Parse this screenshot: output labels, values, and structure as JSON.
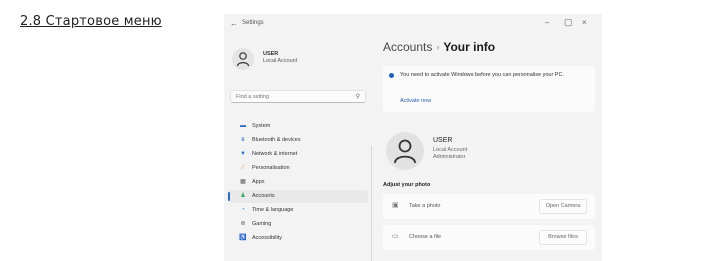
{
  "document": {
    "heading": "2.8 Стартовое меню"
  },
  "window": {
    "title": "Settings",
    "controls": {
      "minimize": "–",
      "maximize": "▢",
      "close": "×"
    }
  },
  "sidebar": {
    "user": {
      "name": "USER",
      "account_type": "Local Account"
    },
    "search": {
      "placeholder": "Find a setting"
    },
    "items": [
      {
        "label": "System",
        "icon": "monitor-icon",
        "color": "#2b6cc4"
      },
      {
        "label": "Bluetooth & devices",
        "icon": "bluetooth-icon",
        "color": "#1f6fd0"
      },
      {
        "label": "Network & internet",
        "icon": "network-icon",
        "color": "#2a6ed0"
      },
      {
        "label": "Personalisation",
        "icon": "brush-icon",
        "color": "#d9822b"
      },
      {
        "label": "Apps",
        "icon": "apps-icon",
        "color": "#555555"
      },
      {
        "label": "Accounts",
        "icon": "person-icon",
        "color": "#2fa85a",
        "active": true
      },
      {
        "label": "Time & language",
        "icon": "globe-clock-icon",
        "color": "#2a86c9"
      },
      {
        "label": "Gaming",
        "icon": "gamepad-icon",
        "color": "#666666"
      },
      {
        "label": "Accessibility",
        "icon": "accessibility-icon",
        "color": "#2b6cc4"
      }
    ]
  },
  "main": {
    "breadcrumb": {
      "parent": "Accounts",
      "separator": "›",
      "current": "Your info"
    },
    "notice": {
      "text": "You need to activate Windows before you can personalise your PC.",
      "link": "Activate now"
    },
    "profile": {
      "name": "USER",
      "account_type": "Local Account",
      "role": "Administrator"
    },
    "adjust_photo": {
      "title": "Adjust your photo",
      "rows": [
        {
          "label": "Take a photo",
          "button": "Open Camera",
          "icon": "camera-icon"
        },
        {
          "label": "Choose a file",
          "button": "Browse files",
          "icon": "folder-icon"
        }
      ]
    }
  },
  "colors": {
    "accent": "#2b6cc4",
    "window_bg": "#f3f3f3",
    "card_bg": "#fbfbfb"
  }
}
